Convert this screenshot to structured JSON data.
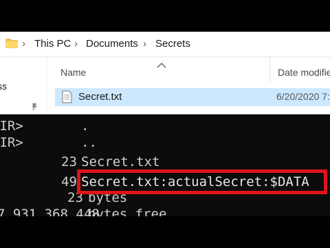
{
  "breadcrumb": {
    "items": [
      "This PC",
      "Documents",
      "Secrets"
    ],
    "separator": "›"
  },
  "navpane": {
    "partial_text": "ss"
  },
  "columns": {
    "name": "Name",
    "date": "Date modifie"
  },
  "files": [
    {
      "name": "Secret.txt",
      "date": "6/20/2020 7:"
    }
  ],
  "terminal": {
    "lines": [
      {
        "left": "DIR>",
        "size": "",
        "name": "."
      },
      {
        "left": "DIR>",
        "size": "",
        "name": ".."
      },
      {
        "left": "",
        "size": "23",
        "name": "Secret.txt"
      },
      {
        "left": "",
        "size": "49",
        "name": "Secret.txt:actualSecret:$DATA"
      },
      {
        "left": "",
        "size": "23",
        "name": "bytes"
      },
      {
        "left": "7,931,368,448",
        "size": "",
        "name": "bytes free"
      }
    ]
  },
  "colors": {
    "selection": "#cce8ff",
    "highlight_border": "#e0131a",
    "terminal_bg": "#0c0c0c",
    "terminal_text": "#d0d0d0"
  },
  "icons": [
    "folder-icon",
    "chevron-right-icon",
    "pin-icon",
    "text-file-icon",
    "sort-up-icon"
  ]
}
